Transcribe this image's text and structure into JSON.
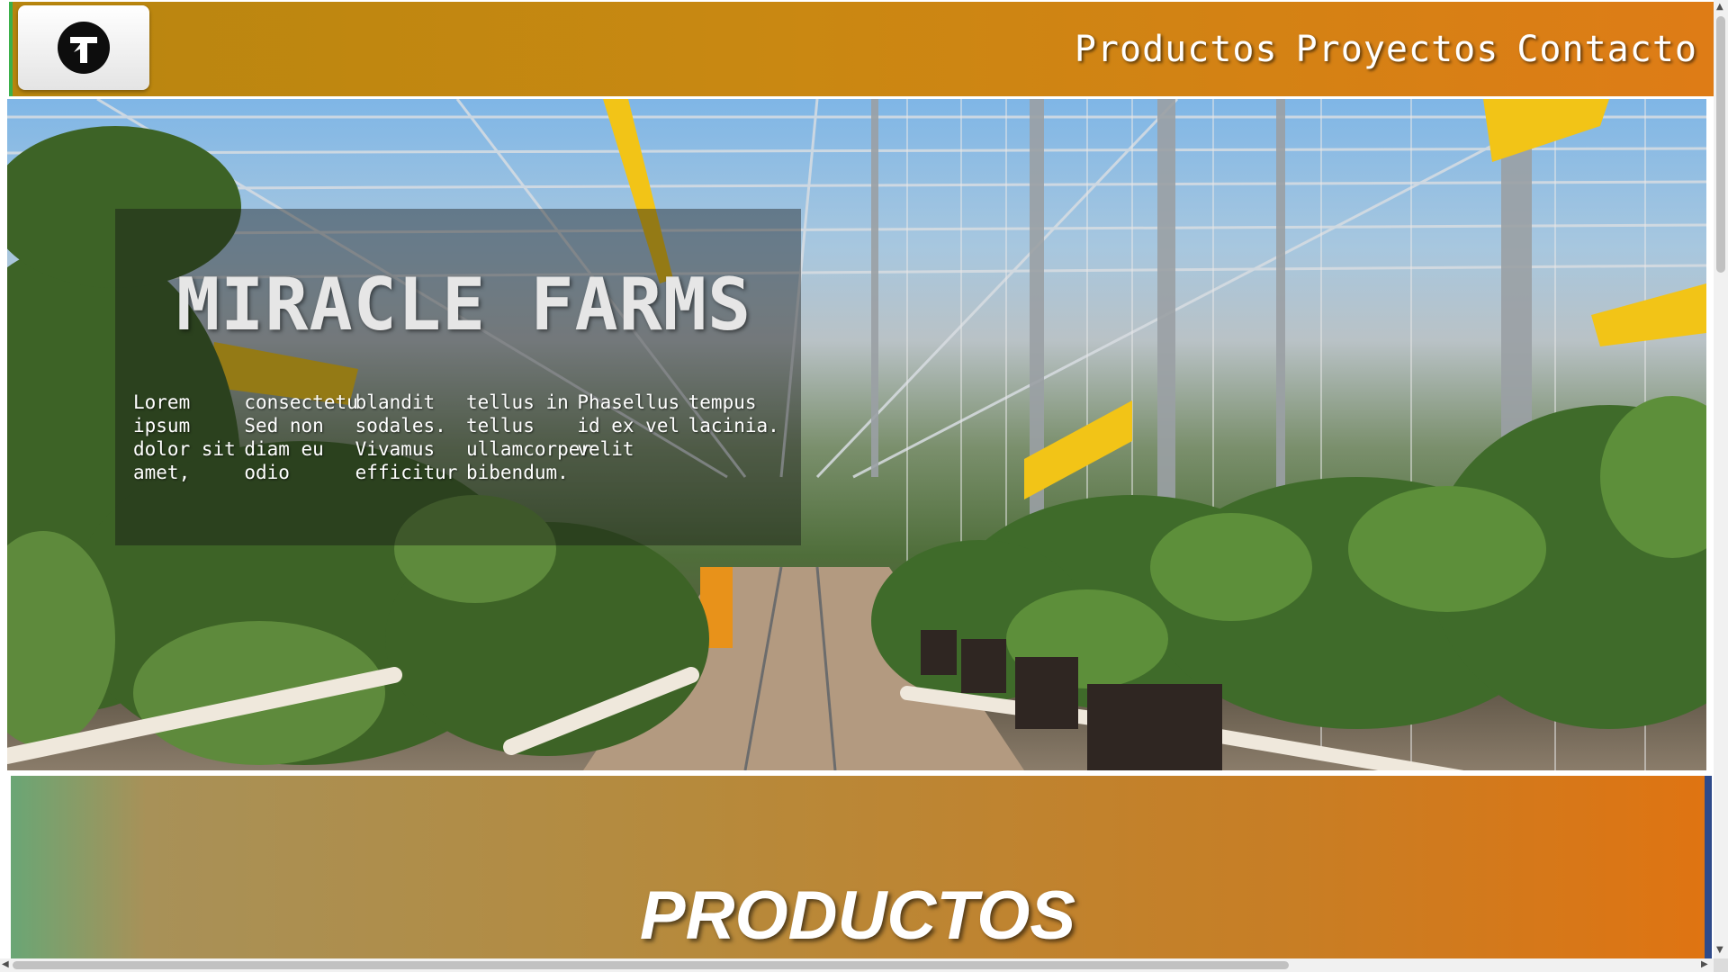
{
  "header": {
    "logo_icon": "t-logo-icon",
    "nav": [
      {
        "label": "Productos"
      },
      {
        "label": "Proyectos"
      },
      {
        "label": "Contacto"
      }
    ]
  },
  "hero": {
    "title": "MIRACLE FARMS",
    "text": "Lorem ipsum dolor sit amet, consectetu Sed non diam eu odio blandit sodales. Vivamus efficitur tellus in tellus ullamcorper bibendum. Phasellus id ex vel velit tempus lacinia.",
    "background_image": "greenhouse-photo"
  },
  "products": {
    "title": "PRODUCTOS"
  },
  "colors": {
    "header_gradient_start": "#b8860f",
    "header_gradient_end": "#de7c16",
    "accent_green": "#3bb04a",
    "products_edge": "#2e4a8a"
  }
}
